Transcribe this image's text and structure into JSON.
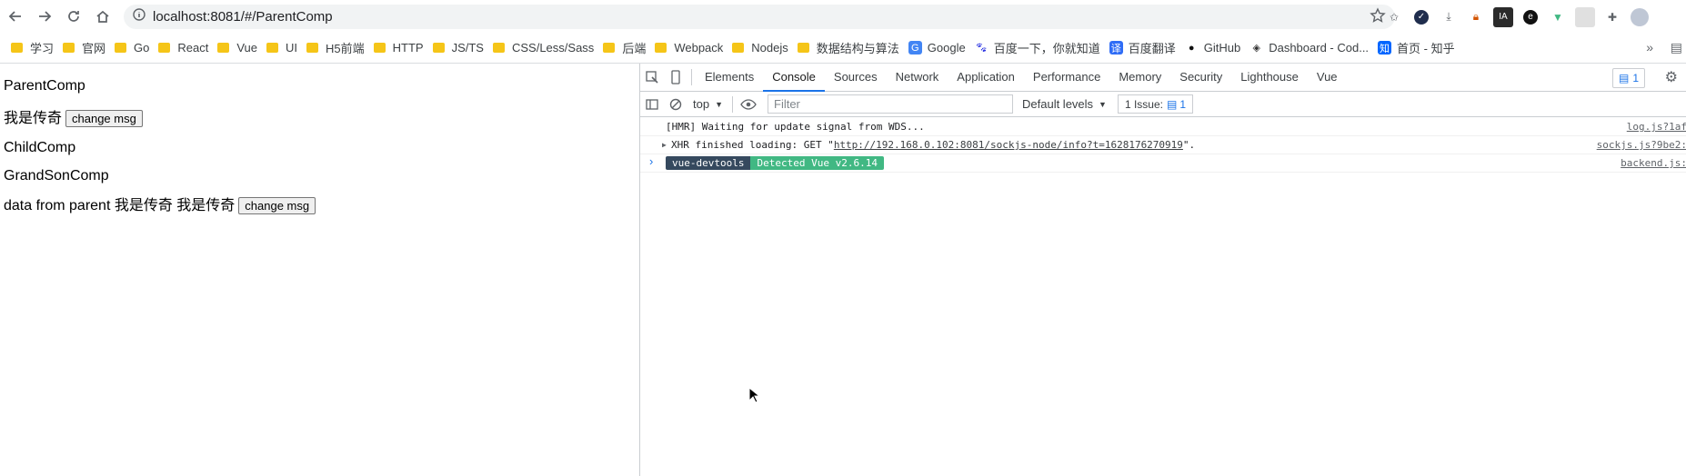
{
  "browser": {
    "url": "localhost:8081/#/ParentComp",
    "bookmarks": [
      {
        "label": "学习",
        "icon": "folder-icon"
      },
      {
        "label": "官网",
        "icon": "folder-icon"
      },
      {
        "label": "Go",
        "icon": "folder-icon"
      },
      {
        "label": "React",
        "icon": "folder-icon"
      },
      {
        "label": "Vue",
        "icon": "folder-icon"
      },
      {
        "label": "UI",
        "icon": "folder-icon"
      },
      {
        "label": "H5前端",
        "icon": "folder-icon"
      },
      {
        "label": "HTTP",
        "icon": "folder-icon"
      },
      {
        "label": "JS/TS",
        "icon": "folder-icon"
      },
      {
        "label": "CSS/Less/Sass",
        "icon": "folder-icon"
      },
      {
        "label": "后端",
        "icon": "folder-icon"
      },
      {
        "label": "Webpack",
        "icon": "folder-icon"
      },
      {
        "label": "Nodejs",
        "icon": "folder-icon"
      },
      {
        "label": "数据结构与算法",
        "icon": "folder-icon"
      },
      {
        "label": "Google",
        "icon": "google-icon"
      },
      {
        "label": "百度一下，你就知道",
        "icon": "baidu-icon"
      },
      {
        "label": "百度翻译",
        "icon": "translate-icon"
      },
      {
        "label": "GitHub",
        "icon": "github-icon"
      },
      {
        "label": "Dashboard - Cod...",
        "icon": "codepen-icon"
      },
      {
        "label": "首页 - 知乎",
        "icon": "zhihu-icon"
      }
    ]
  },
  "page": {
    "parent_title": "ParentComp",
    "parent_msg": "我是传奇",
    "change_btn": "change msg",
    "child_title": "ChildComp",
    "grandson_title": "GrandSonComp",
    "data_line": "data from parent 我是传奇 我是传奇",
    "change_btn2": "change msg"
  },
  "devtools": {
    "tabs": [
      "Elements",
      "Console",
      "Sources",
      "Network",
      "Application",
      "Performance",
      "Memory",
      "Security",
      "Lighthouse",
      "Vue"
    ],
    "active_tab": "Console",
    "issues_count": "1",
    "context": "top",
    "filter_placeholder": "Filter",
    "levels": "Default levels",
    "issue_chip": "1 Issue:",
    "issue_chip_count": "1",
    "logs": {
      "hmr": "[HMR] Waiting for update signal from WDS...",
      "hmr_src": "log.js?1af",
      "xhr_prefix": "XHR finished loading: GET \"",
      "xhr_url": "http://192.168.0.102:8081/sockjs-node/info?t=1628176270919",
      "xhr_suffix": "\".",
      "xhr_src": "sockjs.js?9be2:",
      "badge1": "vue-devtools",
      "badge2": "Detected Vue v2.6.14",
      "badge_src": "backend.js:"
    },
    "prompt": "›"
  },
  "colors": {
    "accent": "#1a73e8",
    "vue_dark": "#35495e",
    "vue_green": "#41b883"
  }
}
